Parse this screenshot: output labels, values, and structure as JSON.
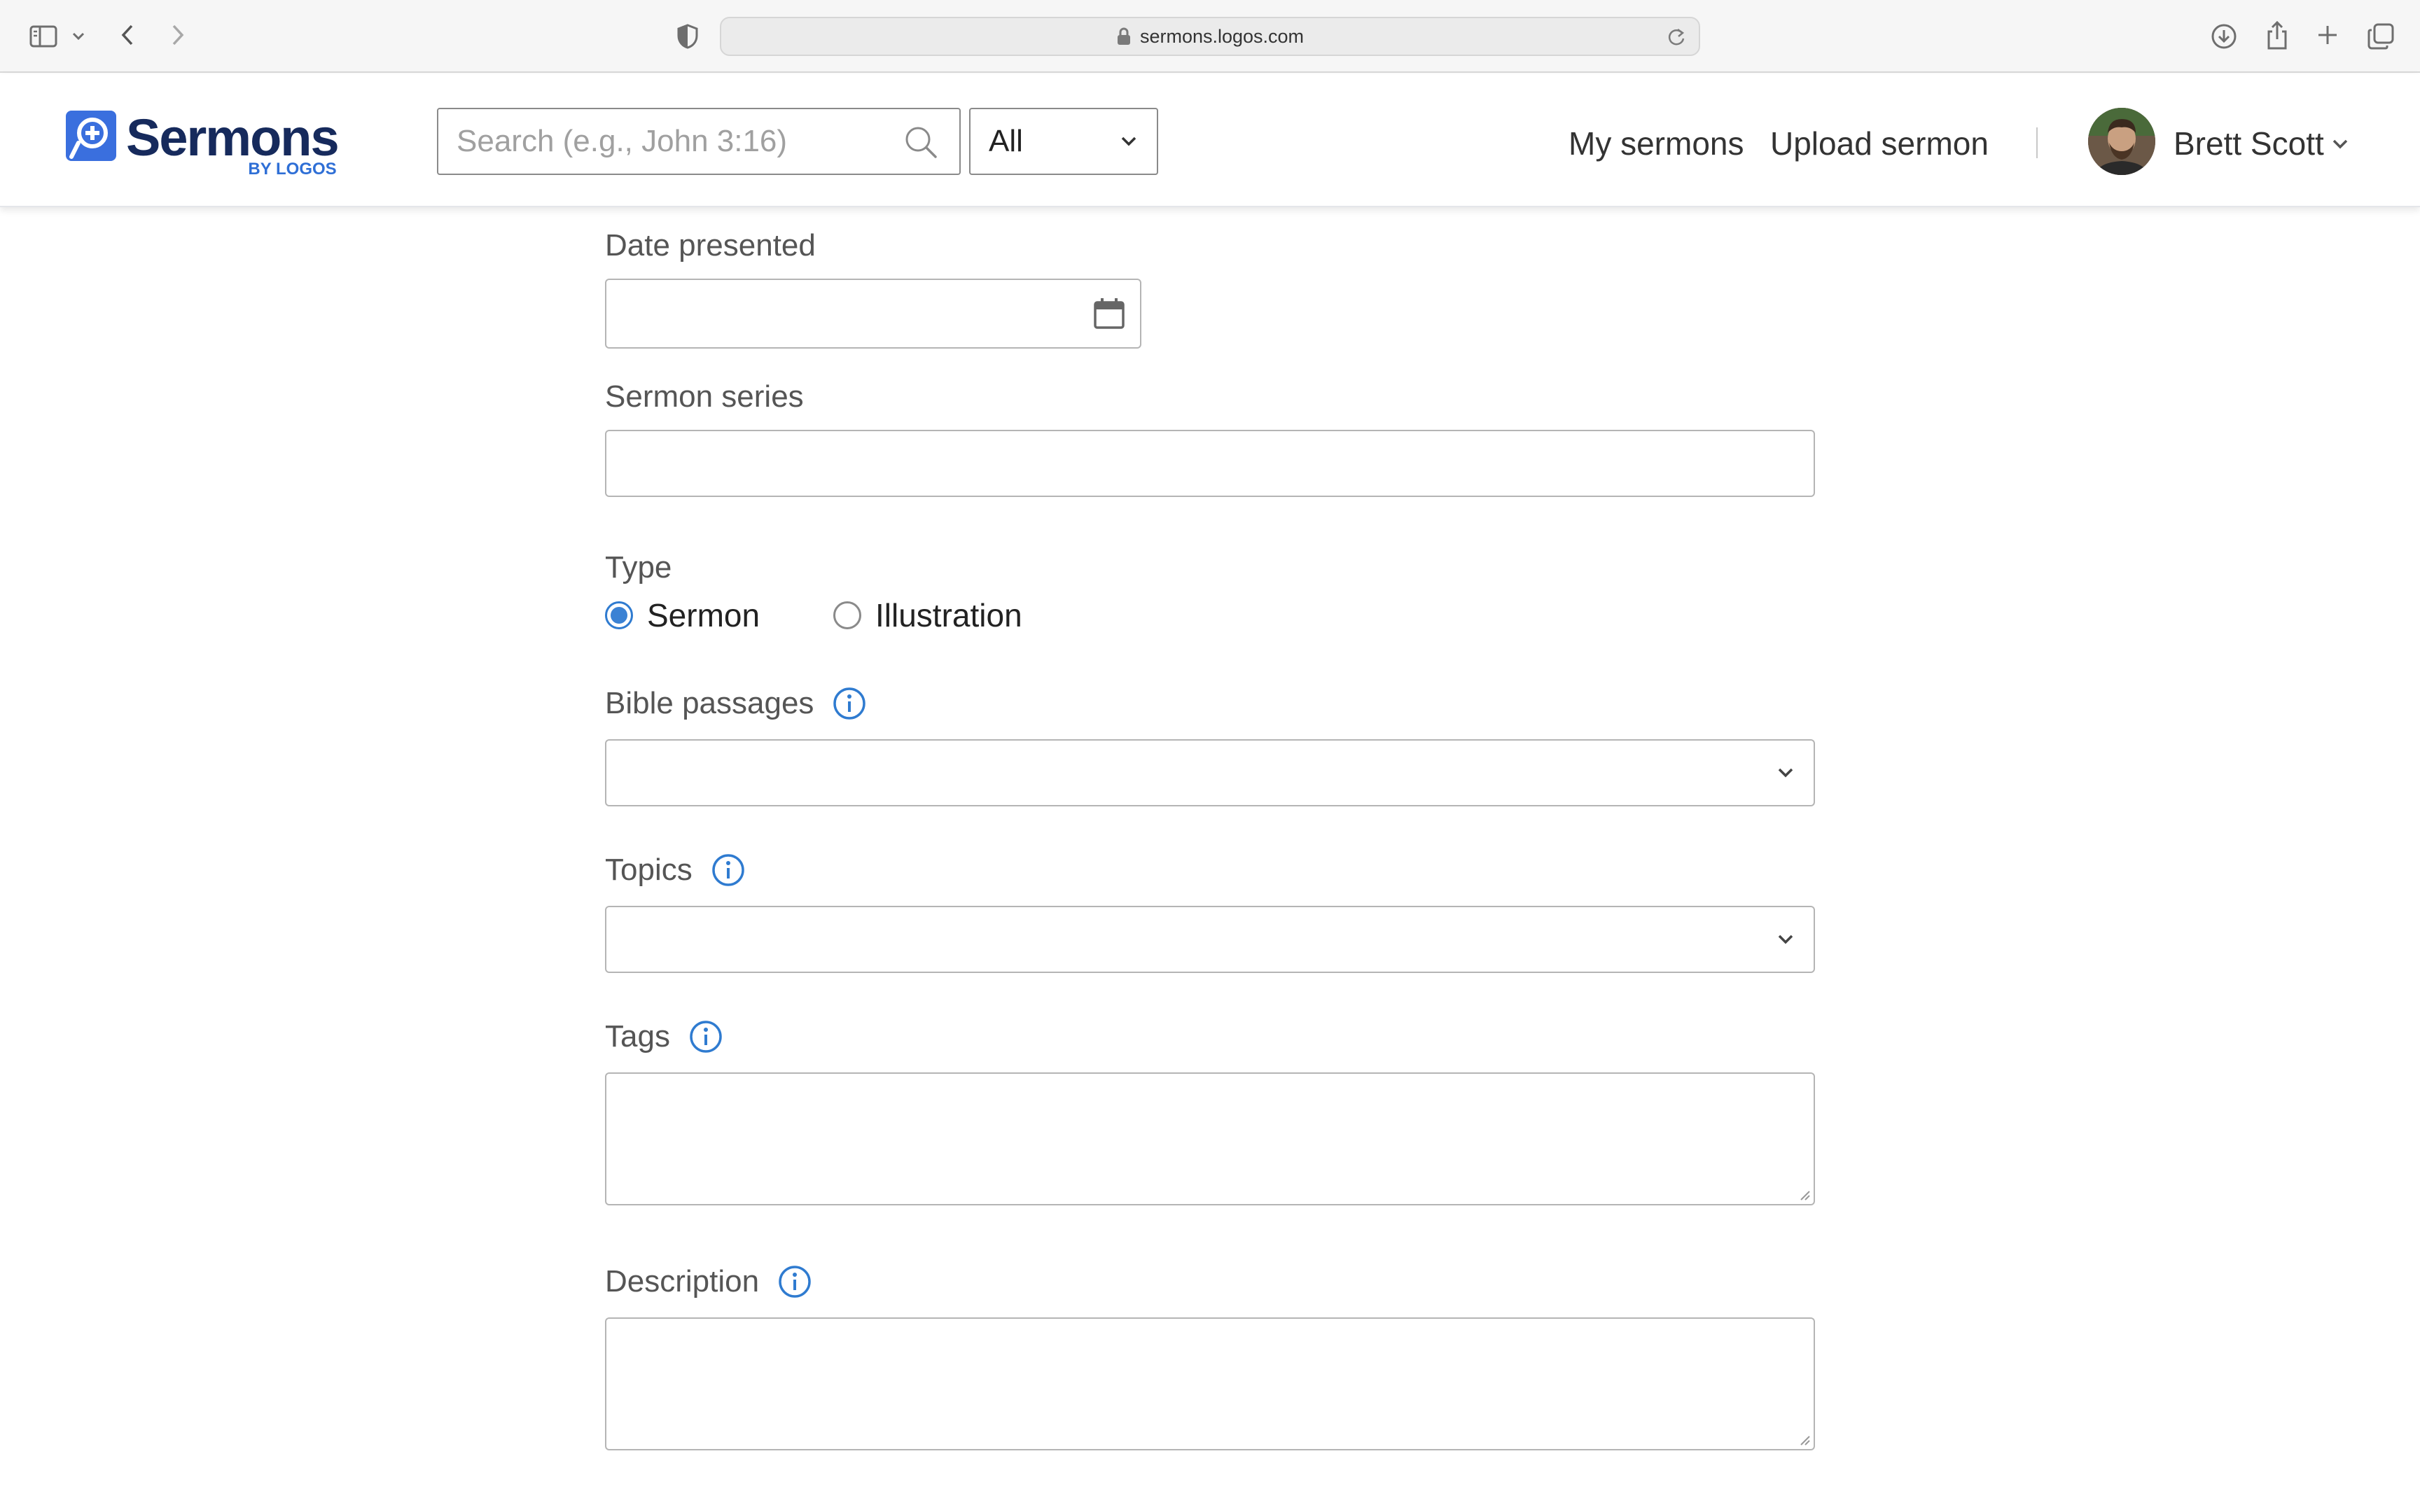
{
  "browser": {
    "url": "sermons.logos.com"
  },
  "header": {
    "logo_word": "Sermons",
    "logo_sub": "BY LOGOS",
    "search": {
      "placeholder": "Search (e.g., John 3:16)",
      "value": ""
    },
    "scope": {
      "selected": "All"
    },
    "nav": {
      "my_sermons": "My sermons",
      "upload_sermon": "Upload sermon"
    },
    "user": {
      "name": "Brett Scott"
    }
  },
  "form": {
    "date_presented": {
      "label": "Date presented",
      "value": ""
    },
    "sermon_series": {
      "label": "Sermon series",
      "value": ""
    },
    "type": {
      "label": "Type",
      "options": [
        {
          "label": "Sermon",
          "checked": true
        },
        {
          "label": "Illustration",
          "checked": false
        }
      ]
    },
    "bible_passages": {
      "label": "Bible passages"
    },
    "topics": {
      "label": "Topics"
    },
    "tags": {
      "label": "Tags",
      "value": ""
    },
    "description": {
      "label": "Description",
      "value": ""
    }
  },
  "colors": {
    "brand_navy": "#162a5c",
    "brand_blue": "#2f6fd6",
    "accent": "#3b82d4"
  }
}
